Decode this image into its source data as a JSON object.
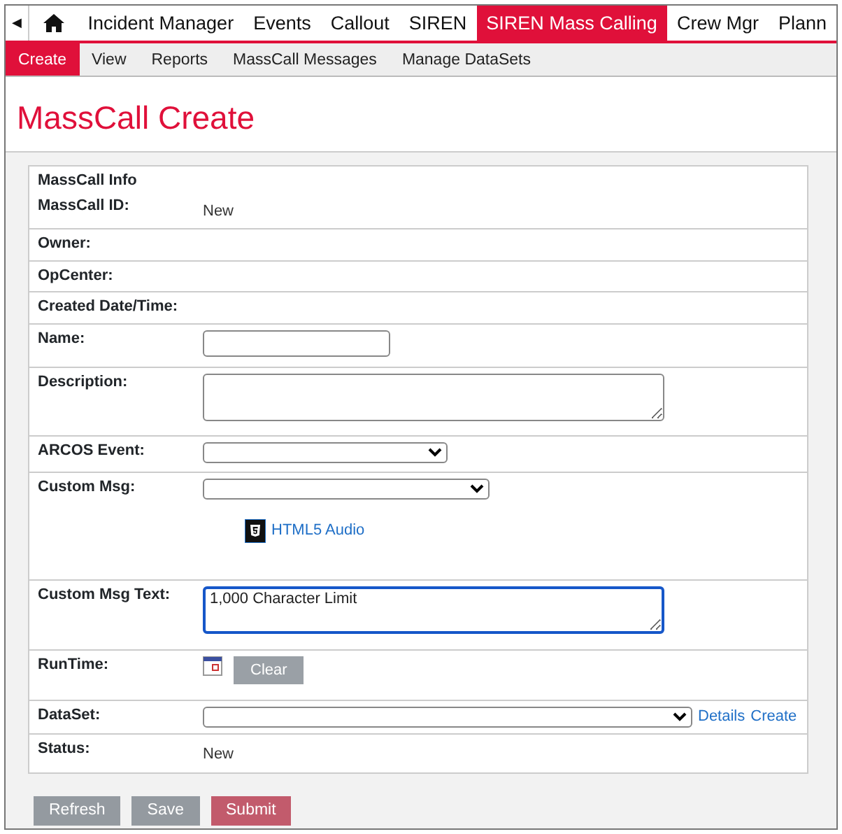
{
  "nav": {
    "back": "◀",
    "tabs": [
      {
        "label": "Incident Manager",
        "selected": false
      },
      {
        "label": "Events",
        "selected": false
      },
      {
        "label": "Callout",
        "selected": false
      },
      {
        "label": "SIREN",
        "selected": false
      },
      {
        "label": "SIREN Mass Calling",
        "selected": true
      },
      {
        "label": "Crew Mgr",
        "selected": false
      },
      {
        "label": "Plann",
        "selected": false
      }
    ]
  },
  "subnav": [
    {
      "label": "Create",
      "selected": true
    },
    {
      "label": "View",
      "selected": false
    },
    {
      "label": "Reports",
      "selected": false
    },
    {
      "label": "MassCall Messages",
      "selected": false
    },
    {
      "label": "Manage DataSets",
      "selected": false
    }
  ],
  "page_title": "MassCall Create",
  "form": {
    "rows": [
      {
        "kind": "header",
        "label": "MassCall Info"
      },
      {
        "kind": "text",
        "label": "MassCall ID:",
        "value": "New"
      },
      {
        "kind": "text",
        "label": "Owner:"
      },
      {
        "kind": "text",
        "label": "OpCenter:"
      },
      {
        "kind": "text",
        "label": "Created Date/Time:"
      },
      {
        "kind": "input",
        "label": "Name:"
      },
      {
        "kind": "textarea",
        "label": "Description:"
      },
      {
        "kind": "select",
        "label": "ARCOS Event:"
      },
      {
        "kind": "select_audio",
        "label": "Custom Msg:",
        "link": "HTML5 Audio"
      },
      {
        "kind": "textarea_focus",
        "label": "Custom Msg Text:",
        "placeholder": "1,000 Character Limit"
      },
      {
        "kind": "date",
        "label": "RunTime:",
        "button": "Clear"
      },
      {
        "kind": "select_links",
        "label": "DataSet:",
        "links": [
          "Details",
          "Create"
        ]
      },
      {
        "kind": "text",
        "label": "Status:",
        "value": "New"
      }
    ]
  },
  "buttons": [
    {
      "label": "Refresh",
      "kind": "secondary"
    },
    {
      "label": "Save",
      "kind": "secondary"
    },
    {
      "label": "Submit",
      "kind": "danger"
    }
  ]
}
